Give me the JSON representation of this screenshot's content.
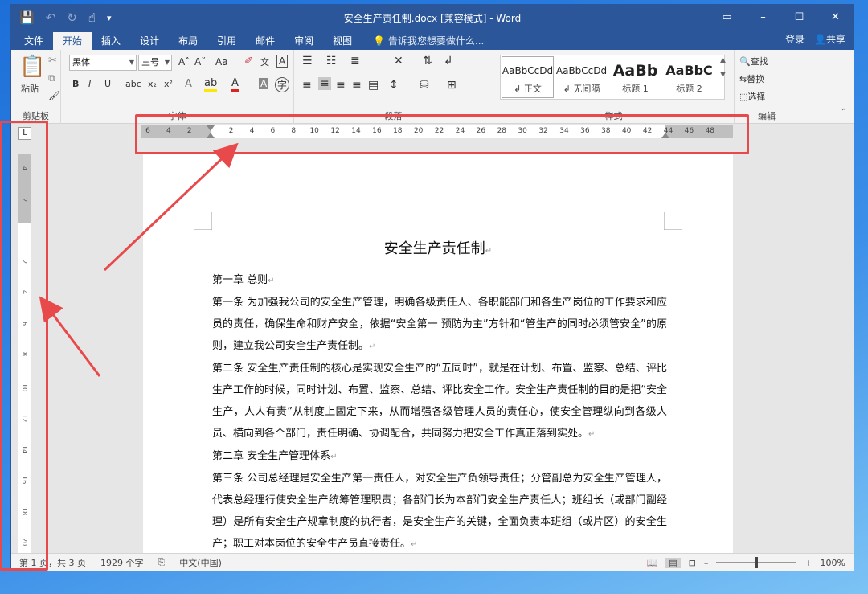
{
  "window": {
    "title": "安全生产责任制.docx [兼容模式] - Word",
    "controls": [
      "▭",
      "–",
      "☐",
      "✕"
    ]
  },
  "quick_access": {
    "save": "💾",
    "undo": "↶",
    "redo": "↻",
    "touch": "☝",
    "more": "▾"
  },
  "tabs": [
    "文件",
    "开始",
    "插入",
    "设计",
    "布局",
    "引用",
    "邮件",
    "审阅",
    "视图"
  ],
  "active_tab": "开始",
  "tell_me": "告诉我您想要做什么...",
  "account": {
    "login": "登录",
    "share": "共享"
  },
  "ribbon": {
    "clipboard": {
      "paste": "粘贴",
      "group": "剪贴板"
    },
    "font": {
      "name": "黑体",
      "size": "三号",
      "group": "字体",
      "buttons": [
        "B",
        "I",
        "U",
        "abc",
        "x₂",
        "x²"
      ],
      "grow": "A˄",
      "shrink": "A˅",
      "case": "Aa",
      "char_a": "A"
    },
    "paragraph": {
      "group": "段落"
    },
    "styles": {
      "group": "样式",
      "items": [
        {
          "preview": "AaBbCcDd",
          "name": "↲ 正文"
        },
        {
          "preview": "AaBbCcDd",
          "name": "↲ 无间隔"
        },
        {
          "preview": "AaBb",
          "name": "标题 1"
        },
        {
          "preview": "AaBbC",
          "name": "标题 2"
        }
      ]
    },
    "editing": {
      "find": "查找",
      "replace": "替换",
      "select": "选择",
      "group": "编辑"
    }
  },
  "ruler": {
    "tab_selector": "L",
    "horizontal_ticks": [
      "6",
      "4",
      "2",
      "",
      "2",
      "4",
      "6",
      "8",
      "10",
      "12",
      "14",
      "16",
      "18",
      "20",
      "22",
      "24",
      "26",
      "28",
      "30",
      "32",
      "34",
      "36",
      "38",
      "40",
      "42",
      "44",
      "46",
      "48"
    ],
    "vertical_ticks": [
      "4",
      "2",
      "",
      "2",
      "4",
      "6",
      "8",
      "10",
      "12",
      "14",
      "16",
      "18",
      "20"
    ]
  },
  "document": {
    "title": "安全生产责任制",
    "paragraphs": [
      "第一章  总则",
      "第一条  为加强我公司的安全生产管理，明确各级责任人、各职能部门和各生产岗位的工作要求和应员的责任，确保生命和财产安全，依据“安全第一  预防为主”方针和“管生产的同时必须管安全”的原则，建立我公司安全生产责任制。",
      "第二条  安全生产责任制的核心是实现安全生产的“五同时”，就是在计划、布置、监察、总结、评比生产工作的时候，同时计划、布置、监察、总结、评比安全工作。安全生产责任制的目的是把“安全生产，人人有责”从制度上固定下来，从而增强各级管理人员的责任心，使安全管理纵向到各级人员、横向到各个部门，责任明确、协调配合，共同努力把安全工作真正落到实处。",
      "第二章  安全生产管理体系",
      "第三条   公司总经理是安全生产第一责任人，对安全生产负领导责任；分管副总为安全生产管理人，代表总经理行使安全生产统筹管理职责；各部门长为本部门安全生产责任人；班组长（或部门副经理）是所有安全生产规章制度的执行者，是安全生产的关键，全面负责本班组（或片区）的安全生产；职工对本岗位的安全生产员直接责任。"
    ]
  },
  "status": {
    "page": "第 1 页，共 3 页",
    "words": "1929 个字",
    "lang": "中文(中国)",
    "zoom": "100%"
  },
  "colors": {
    "brand": "#2b579a",
    "annotation": "#e8494b"
  }
}
